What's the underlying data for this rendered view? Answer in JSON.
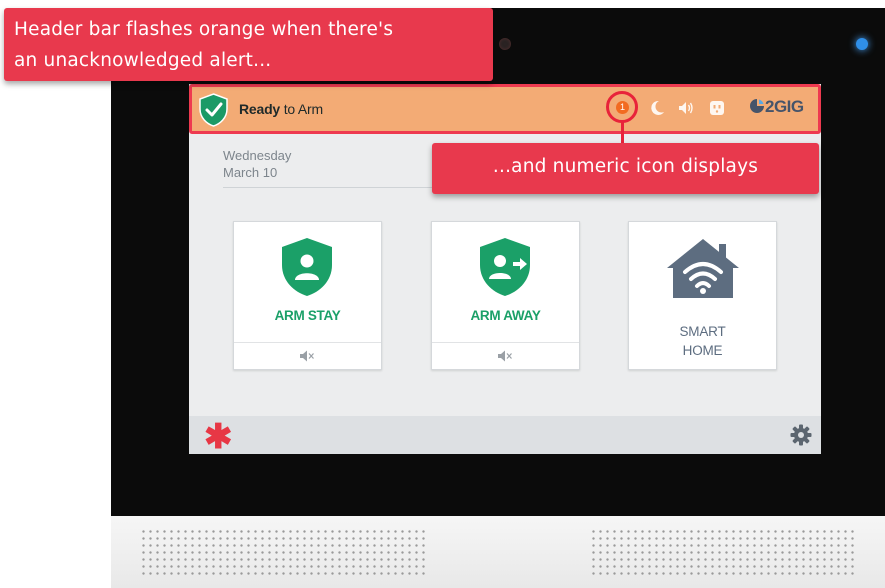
{
  "header": {
    "status_text_bold": "Ready",
    "status_text_rest": " to Arm",
    "alert_count": "1",
    "brand": "2GIG"
  },
  "date": {
    "day": "Wednesday",
    "date": "March 10"
  },
  "tiles": {
    "arm_stay": "ARM STAY",
    "arm_away": "ARM AWAY",
    "smart_home_line1": "SMART",
    "smart_home_line2": "HOME"
  },
  "footer": {
    "emergency_symbol": "✱"
  },
  "annotations": {
    "top_line1": "Header bar flashes orange when there's",
    "top_line2": "an unacknowledged alert...",
    "middle": "...and numeric icon displays"
  },
  "icons": {
    "status": "shield-check-icon",
    "night": "moon-icon",
    "volume": "speaker-icon",
    "outlet": "outlet-icon",
    "brand_mark": "2gig-logo-icon",
    "arm_stay": "shield-person-icon",
    "arm_away": "shield-person-arrow-icon",
    "smart_home": "house-wifi-icon",
    "mute": "speaker-muted-icon",
    "settings": "gear-icon"
  },
  "colors": {
    "alert_header": "#f3ab75",
    "alert_border": "#ee3a50",
    "accent_green": "#1ba068",
    "callout_red": "#e8394d",
    "badge_orange": "#f26b21"
  }
}
